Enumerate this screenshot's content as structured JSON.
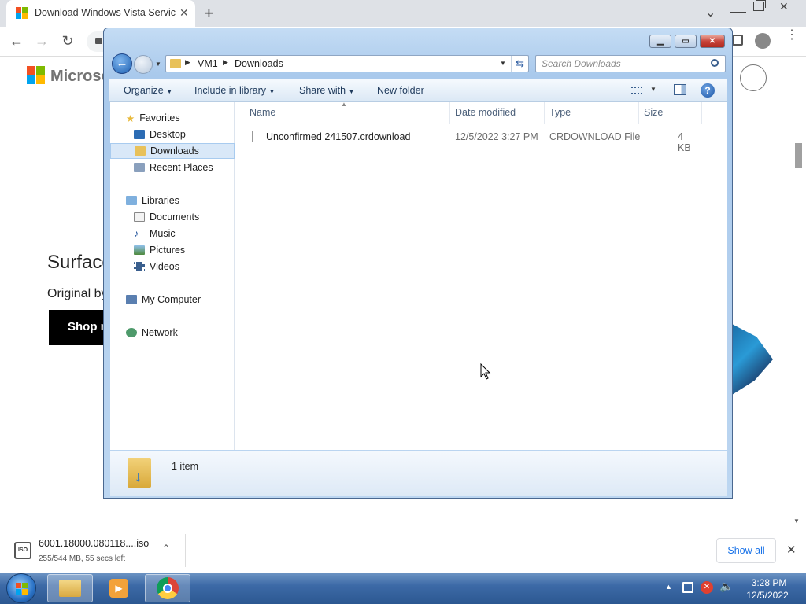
{
  "chrome": {
    "tab_title": "Download Windows Vista Service",
    "new_tab": "+",
    "tab_menu": "⌄"
  },
  "webpage": {
    "brand": "Microsoft",
    "headline": "Surface",
    "subline": "Original by",
    "shop_button": "Shop n"
  },
  "download_bar": {
    "file_name": "6001.18000.080118....iso",
    "progress": "255/544 MB, 55 secs left",
    "progress_fraction": 0.47,
    "show_all": "Show all"
  },
  "explorer": {
    "breadcrumb": [
      "VM1",
      "Downloads"
    ],
    "search_placeholder": "Search Downloads",
    "commands": {
      "organize": "Organize",
      "include": "Include in library",
      "share": "Share with",
      "new_folder": "New folder"
    },
    "nav": {
      "favorites": "Favorites",
      "desktop": "Desktop",
      "downloads": "Downloads",
      "recent": "Recent Places",
      "libraries": "Libraries",
      "documents": "Documents",
      "music": "Music",
      "pictures": "Pictures",
      "videos": "Videos",
      "computer": "My Computer",
      "network": "Network"
    },
    "columns": {
      "name": "Name",
      "date": "Date modified",
      "type": "Type",
      "size": "Size"
    },
    "files": [
      {
        "name": "Unconfirmed 241507.crdownload",
        "date": "12/5/2022 3:27 PM",
        "type": "CRDOWNLOAD File",
        "size": "4 KB"
      }
    ],
    "item_count": "1 item"
  },
  "taskbar": {
    "time": "3:28 PM",
    "date": "12/5/2022"
  },
  "colors": {
    "accent_chrome": "#1a73e8",
    "explorer_frame": "#a9c9ec",
    "taskbar": "#3d6aa7",
    "close_red": "#c8453b"
  }
}
